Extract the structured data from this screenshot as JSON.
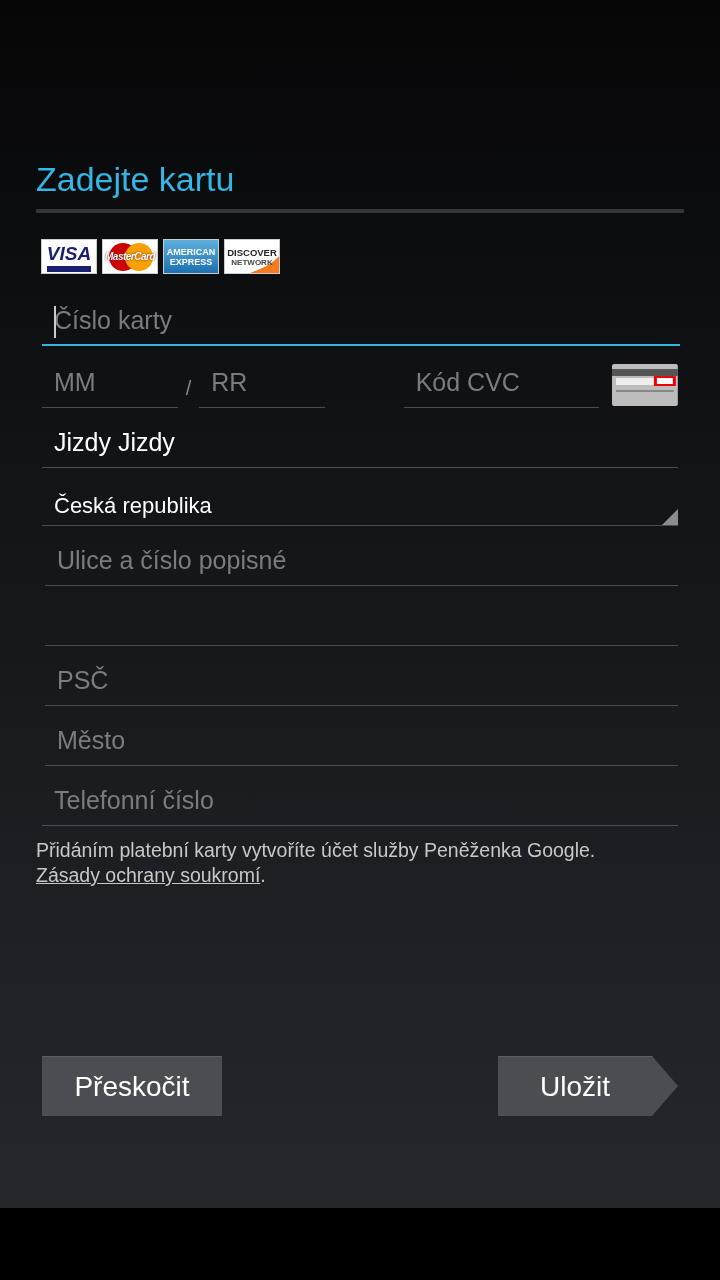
{
  "title": "Zadejte kartu",
  "card_logos": [
    {
      "kind": "visa",
      "label": "VISA"
    },
    {
      "kind": "mastercard",
      "label": "MasterCard"
    },
    {
      "kind": "amex",
      "label": "AMERICAN EXPRESS"
    },
    {
      "kind": "discover",
      "label": "DISCOVER",
      "sublabel": "NETWORK"
    }
  ],
  "card_number": {
    "placeholder": "Číslo karty",
    "focused": true
  },
  "expiry_month": {
    "placeholder": "MM"
  },
  "separator": "/",
  "expiry_year": {
    "placeholder": "RR"
  },
  "cvc": {
    "placeholder": "Kód CVC"
  },
  "name": {
    "value": "Jizdy Jizdy"
  },
  "country": {
    "value": "Česká republika"
  },
  "address_fields": [
    {
      "kind": "hinted",
      "placeholder": "Ulice a číslo popisné"
    },
    {
      "kind": "blank"
    },
    {
      "kind": "hinted",
      "placeholder": "PSČ"
    },
    {
      "kind": "hinted",
      "placeholder": "Město"
    }
  ],
  "phone": {
    "placeholder": "Telefonní číslo"
  },
  "notice": {
    "text": "Přidáním platební karty vytvoříte účet služby Peněženka Google.",
    "link": "Zásady ochrany soukromí",
    "after": "."
  },
  "buttons": {
    "skip": "Přeskočit",
    "save": "Uložit"
  }
}
